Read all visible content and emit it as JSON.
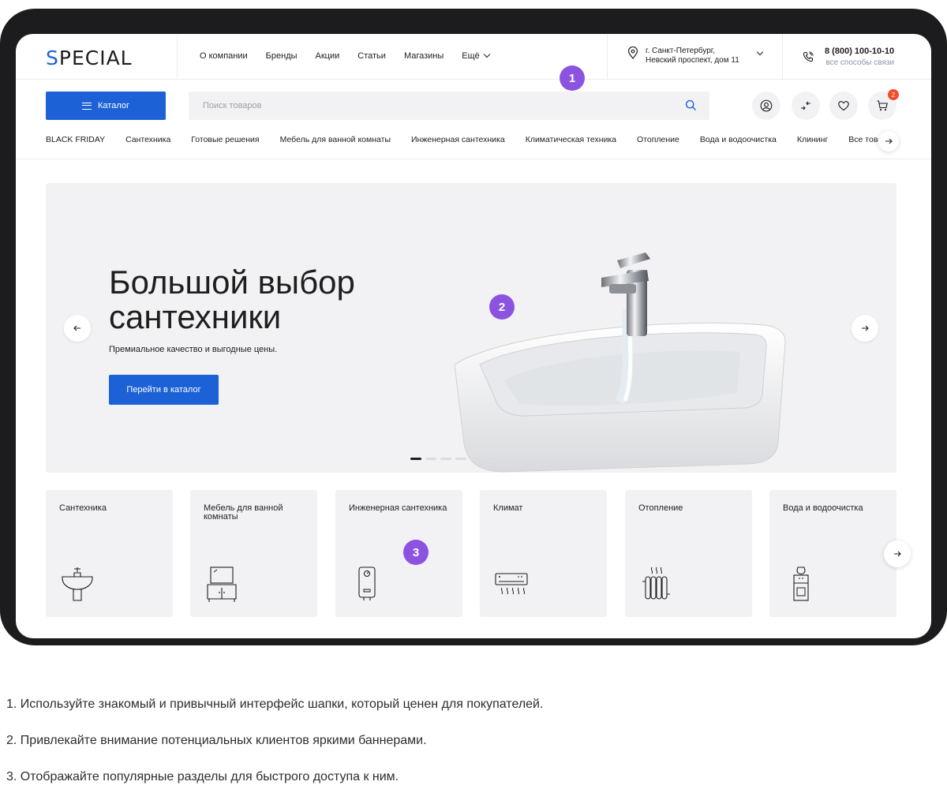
{
  "header": {
    "logo": "SPECIAL",
    "nav": [
      "О компании",
      "Бренды",
      "Акции",
      "Статьи",
      "Магазины"
    ],
    "nav_more": "Ещё",
    "address_line1": "г. Санкт-Петербург,",
    "address_line2": "Невский проспект, дом 11",
    "phone": "8 (800) 100-10-10",
    "phone_sub": "все способы связи"
  },
  "toolbar": {
    "catalog_label": "Каталог",
    "search_placeholder": "Поиск товаров",
    "cart_count": "2"
  },
  "categories_nav": [
    "BLACK FRIDAY",
    "Сантехника",
    "Готовые решения",
    "Мебель для ванной комнаты",
    "Инженерная сантехника",
    "Климатическая техника",
    "Отопление",
    "Вода и водоочистка",
    "Клининг",
    "Все товары"
  ],
  "hero": {
    "title_line1": "Большой выбор",
    "title_line2": "сантехники",
    "subtitle": "Премиальное качество и выгодные цены.",
    "button": "Перейти в каталог",
    "slides_count": 6,
    "active_slide": 1
  },
  "cards": [
    {
      "label": "Сантехника",
      "icon": "sink-icon"
    },
    {
      "label": "Мебель для ванной комнаты",
      "icon": "vanity-icon"
    },
    {
      "label": "Инженерная сантехника",
      "icon": "water-heater-icon"
    },
    {
      "label": "Климат",
      "icon": "air-conditioner-icon"
    },
    {
      "label": "Отопление",
      "icon": "radiator-icon"
    },
    {
      "label": "Вода и водоочистка",
      "icon": "water-cooler-icon"
    }
  ],
  "badges": [
    "1",
    "2",
    "3"
  ],
  "notes": [
    "1. Используйте знакомый и привычный интерфейс шапки, который ценен для покупателей.",
    "2. Привлекайте внимание потенциальных клиентов яркими баннерами.",
    "3. Отображайте популярные разделы для быстрого доступа к ним."
  ],
  "colors": {
    "accent": "#1c61d6",
    "badge": "#8c53e0",
    "cart_badge": "#f04e2b",
    "frame": "#1c1c1e",
    "panel": "#f2f2f4"
  }
}
